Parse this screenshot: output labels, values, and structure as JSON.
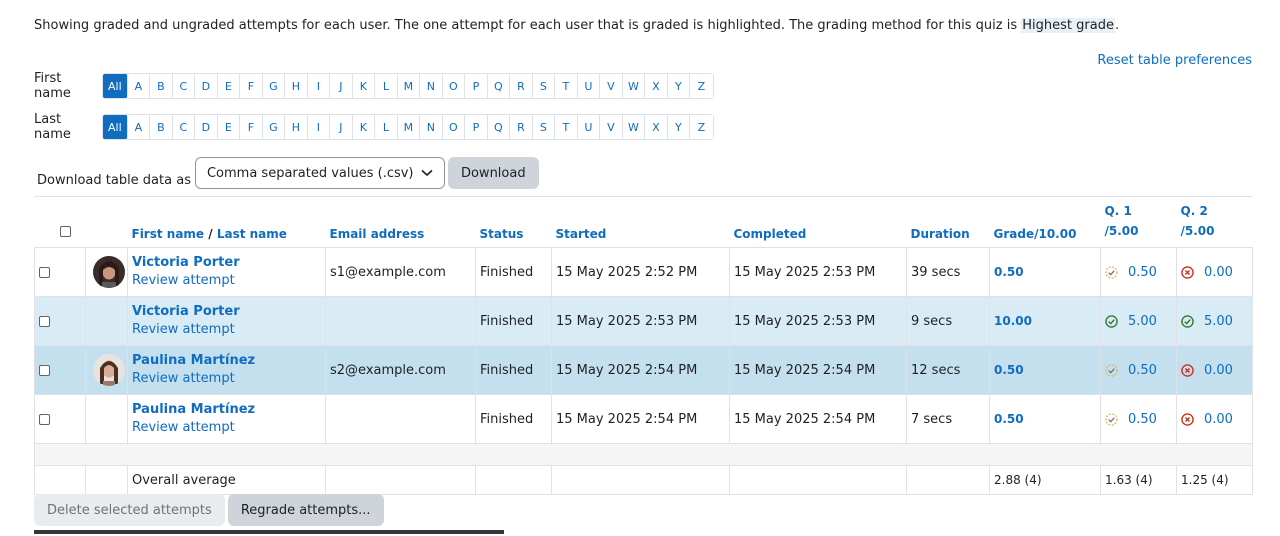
{
  "intro": {
    "text": "Showing graded and ungraded attempts for each user. The one attempt for each user that is graded is highlighted. The grading method for this quiz is ",
    "method": "Highest grade",
    "end": "."
  },
  "reset_label": "Reset table preferences",
  "first_name_filter": {
    "label": "First name",
    "letters": [
      "All",
      "A",
      "B",
      "C",
      "D",
      "E",
      "F",
      "G",
      "H",
      "I",
      "J",
      "K",
      "L",
      "M",
      "N",
      "O",
      "P",
      "Q",
      "R",
      "S",
      "T",
      "U",
      "V",
      "W",
      "X",
      "Y",
      "Z"
    ]
  },
  "last_name_filter": {
    "label": "Last name",
    "letters": [
      "All",
      "A",
      "B",
      "C",
      "D",
      "E",
      "F",
      "G",
      "H",
      "I",
      "J",
      "K",
      "L",
      "M",
      "N",
      "O",
      "P",
      "Q",
      "R",
      "S",
      "T",
      "U",
      "V",
      "W",
      "X",
      "Y",
      "Z"
    ]
  },
  "download": {
    "label": "Download table data as",
    "selected": "Comma separated values (.csv)",
    "button": "Download"
  },
  "table": {
    "headers": {
      "first_name": "First name",
      "separator": " / ",
      "last_name": "Last name",
      "email": "Email address",
      "status": "Status",
      "started": "Started",
      "completed": "Completed",
      "duration": "Duration",
      "grade": "Grade/10.00",
      "q1_line1": "Q. 1",
      "q1_line2": "/5.00",
      "q2_line1": "Q. 2",
      "q2_line2": "/5.00"
    },
    "rows": [
      {
        "name": "Victoria Porter",
        "review": "Review attempt",
        "email": "s1@example.com",
        "status": "Finished",
        "started": "15 May 2025 2:52 PM",
        "completed": "15 May 2025 2:53 PM",
        "duration": "39 secs",
        "grade": "0.50",
        "q1": "0.50",
        "q1_state": "partial",
        "q2": "0.00",
        "q2_state": "incorrect",
        "avatar": "avatar-1"
      },
      {
        "name": "Victoria Porter",
        "review": "Review attempt",
        "email": "",
        "status": "Finished",
        "started": "15 May 2025 2:53 PM",
        "completed": "15 May 2025 2:53 PM",
        "duration": "9 secs",
        "grade": "10.00",
        "q1": "5.00",
        "q1_state": "correct",
        "q2": "5.00",
        "q2_state": "correct",
        "avatar": ""
      },
      {
        "name": "Paulina Martínez",
        "review": "Review attempt",
        "email": "s2@example.com",
        "status": "Finished",
        "started": "15 May 2025 2:54 PM",
        "completed": "15 May 2025 2:54 PM",
        "duration": "12 secs",
        "grade": "0.50",
        "q1": "0.50",
        "q1_state": "partial",
        "q2": "0.00",
        "q2_state": "incorrect",
        "avatar": "avatar-2"
      },
      {
        "name": "Paulina Martínez",
        "review": "Review attempt",
        "email": "",
        "status": "Finished",
        "started": "15 May 2025 2:54 PM",
        "completed": "15 May 2025 2:54 PM",
        "duration": "7 secs",
        "grade": "0.50",
        "q1": "0.50",
        "q1_state": "partial",
        "q2": "0.00",
        "q2_state": "incorrect",
        "avatar": ""
      }
    ],
    "average": {
      "label": "Overall average",
      "grade": "2.88 (4)",
      "q1": "1.63 (4)",
      "q2": "1.25 (4)"
    }
  },
  "actions": {
    "delete": "Delete selected attempts",
    "regrade": "Regrade attempts..."
  },
  "colors": {
    "link": "#0f6cbf",
    "correct": "#357a32",
    "incorrect": "#ca3120",
    "partial": "#f0ad4e",
    "highlight_row": "#d9ecf5"
  }
}
